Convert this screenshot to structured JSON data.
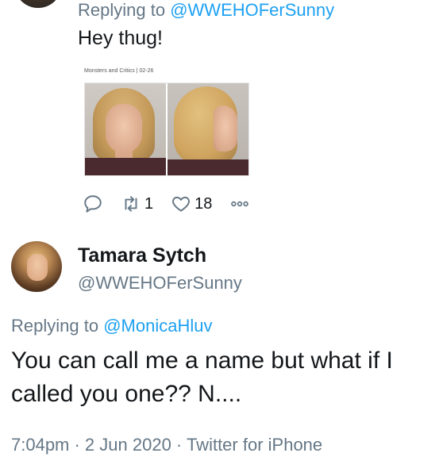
{
  "tweet_top": {
    "replying_prefix": "Replying to",
    "replying_handle": "@WWEHOFerSunny",
    "text": "Hey thug!",
    "media_caption": "Monsters and Critics | 02-26",
    "actions": {
      "reply_icon": "comment-icon",
      "retweet_icon": "retweet-icon",
      "retweet_count": "1",
      "like_icon": "heart-icon",
      "like_count": "18",
      "more_icon": "more-icon"
    }
  },
  "tweet_main": {
    "display_name": "Tamara Sytch",
    "handle": "@WWEHOFerSunny",
    "replying_prefix": "Replying to",
    "replying_handle": "@MonicaHluv",
    "text": "You can call me a name but what if I called you one?? N....",
    "meta": "7:04pm · 2 Jun 2020 · Twitter for iPhone"
  },
  "colors": {
    "link": "#1da1f2",
    "muted": "#657786",
    "text": "#14171a"
  }
}
